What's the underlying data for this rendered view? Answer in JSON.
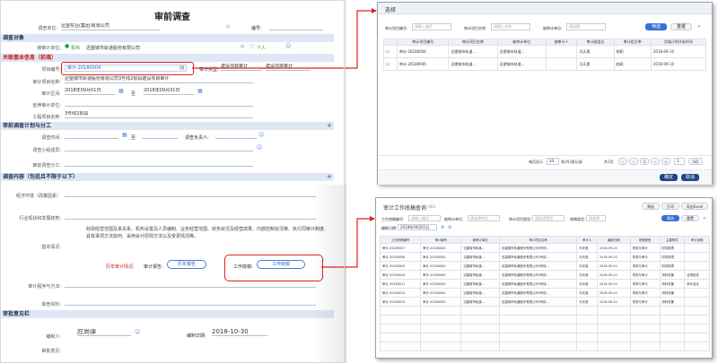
{
  "form": {
    "title": "审前调查",
    "unit_label": "调查单位:",
    "unit_value": "迅望实业(集团)有限公司",
    "no_label": "编号:",
    "s1": "调查对象",
    "audited_label": "被审计单位:",
    "audited_tag": "机构",
    "audited_value": "迅望城市轨道股份有限公司",
    "person_tag": "个人",
    "s2": "关联基本信息（前填）",
    "proj_no_label": "项目编号:",
    "proj_no_value": "审计-20180004",
    "type_label": "审计类型:",
    "type_value": "建设项目审计",
    "type_value2": "建设项目审计",
    "proj_name_label": "审计项目名称:",
    "proj_name_value": "迅望城市轨道股份有限公司3号线2标段建设项目审计",
    "period_label": "审计区间:",
    "period_start": "2018年09月01日",
    "period_to": "至",
    "period_end": "2018年09月31日",
    "ext_label": "延伸审计单位:",
    "contract_label": "工程项目名称:",
    "contract_value": "3号线2标段",
    "s3": "审前调查计划与分工",
    "survey_time_label": "调查时间:",
    "survey_to": "至",
    "leader_label": "调查负责人:",
    "members_label": "调查小组成员:",
    "division_label": "审前调查分工:",
    "s4": "调查内容（包括且不限于以下）",
    "env_label": "经济环境（政策因素）",
    "industry_label": "行业现状和发展趋势:",
    "industry_text": "财政经营范围及事关系、机构设置及人员编制、业务经营范围、财务状况及经营成果、内部控制状况等、执行同审计制度、具有事项方法如何、采用会计原则方法以及变更情况等。",
    "basic_label": "基本情况:",
    "history_label": "历年审计情况:",
    "report_label": "审计报告:",
    "report_btn": "历年报告",
    "paper_label": "工作底稿:",
    "paper_btn": "工作底稿",
    "method_label": "审计程序与方法:",
    "other_label": "其他资料:",
    "s5": "审批意见栏",
    "editor_label": "编制人:",
    "editor_value": "应尚弹",
    "date_label": "编制日期:",
    "date_value": "2018-10-30",
    "review_label": "审批意见:"
  },
  "modal1": {
    "title": "选择",
    "f1_label": "审计项目编号:",
    "f1_ph": "请输入编号",
    "f2_label": "审计项目名称:",
    "f2_ph": "请输入名称",
    "f3_label": "被审计单位:",
    "f3_ph": "请选择",
    "search_btn": "筛选",
    "reset_btn": "重置",
    "headers": [
      "审计项目编号",
      "审计项目名称",
      "被审计单位",
      "被审计人",
      "审计组组长",
      "审计组主审",
      "实施计划开始时间"
    ],
    "rows": [
      [
        "审计-20180004",
        "迅望城市轨道...",
        "迅望城市轨道...",
        "",
        "冯天奥",
        "柏昭",
        "2018-09-10"
      ],
      [
        "审计-20180006",
        "迅望城市轨道...",
        "迅望城市轨道...",
        "",
        "冯天奥",
        "柏昭",
        "2018-09-10"
      ]
    ],
    "page_size_label": "每页显示",
    "page_size": "20",
    "page_unit": "条/共3条记录",
    "total": "共1页",
    "page_current": "1",
    "page_total": "1",
    "go_btn": "GO",
    "ok_btn": "确定",
    "cancel_btn": "取消"
  },
  "modal2": {
    "title": "审计工作底稿查询",
    "badge": "(85)",
    "btn_a": "筛选",
    "btn_b": "打印",
    "btn_c": "导出Excel",
    "f1_label": "工作底稿编号:",
    "f1_ph": "请输入编号",
    "f2_label": "被审计单位:",
    "f2_ph": "请选择单位",
    "f3_label": "审计项目类型:",
    "f3_ph": "请选择类型",
    "f4_label": "底稿类型:",
    "f4_ph": "请选择",
    "date_label": "编制日期:",
    "date_value": "2018年09月01日",
    "search_btn": "筛选",
    "reset_btn": "重置",
    "headers": [
      "工作底稿编号",
      "审计编号",
      "被审计单位",
      "审计项目名称",
      "审计人",
      "编制日期",
      "底稿类型",
      "主要附件",
      "审计说明"
    ],
    "rows": [
      [
        "审计-20180007",
        "审计-20180004",
        "迅望城市轨道...",
        "迅望城市轨道股份有限公司3号线...",
        "冯天奥",
        "2018-09-10",
        "财务与审计",
        "财务报表",
        ""
      ],
      [
        "审计-20180008",
        "审计-20180004",
        "迅望城市轨道...",
        "迅望城市轨道股份有限公司3号线...",
        "冯天奥",
        "2018-09-10",
        "财务与审计",
        "财务报表",
        ""
      ],
      [
        "审计-20180009",
        "审计-20180004",
        "迅望城市轨道...",
        "迅望城市轨道股份有限公司3号线...",
        "冯天奥",
        "2018-09-10",
        "财务与审计",
        "财务报表",
        ""
      ],
      [
        "审计-20180010",
        "审计-20180004",
        "迅望城市轨道...",
        "迅望城市轨道股份有限公司3号线...",
        "冯天奥",
        "2018-09-10",
        "财务与审计",
        "资料收集",
        "合规检查"
      ],
      [
        "审计-20180011",
        "审计-20180004",
        "迅望城市轨道...",
        "迅望城市轨道股份有限公司3号线...",
        "冯天奥",
        "2018-09-10",
        "财务与审计",
        "资料收集",
        "审计结论"
      ],
      [
        "审计-20180012",
        "审计-20180004",
        "迅望城市轨道...",
        "迅望城市轨道股份有限公司3号线...",
        "冯天奥",
        "2018-09-10",
        "财务与审计",
        "资料收集",
        ""
      ],
      [
        "审计-20180013",
        "审计-20180004",
        "迅望城市轨道...",
        "迅望城市轨道股份有限公司3号线...",
        "冯天奥",
        "2018-09-10",
        "财务与审计",
        "资料收集",
        ""
      ]
    ]
  },
  "colors": {
    "accent": "#3a6fd8",
    "highlight": "#e02020",
    "section_bg": "#dfe7f4"
  }
}
